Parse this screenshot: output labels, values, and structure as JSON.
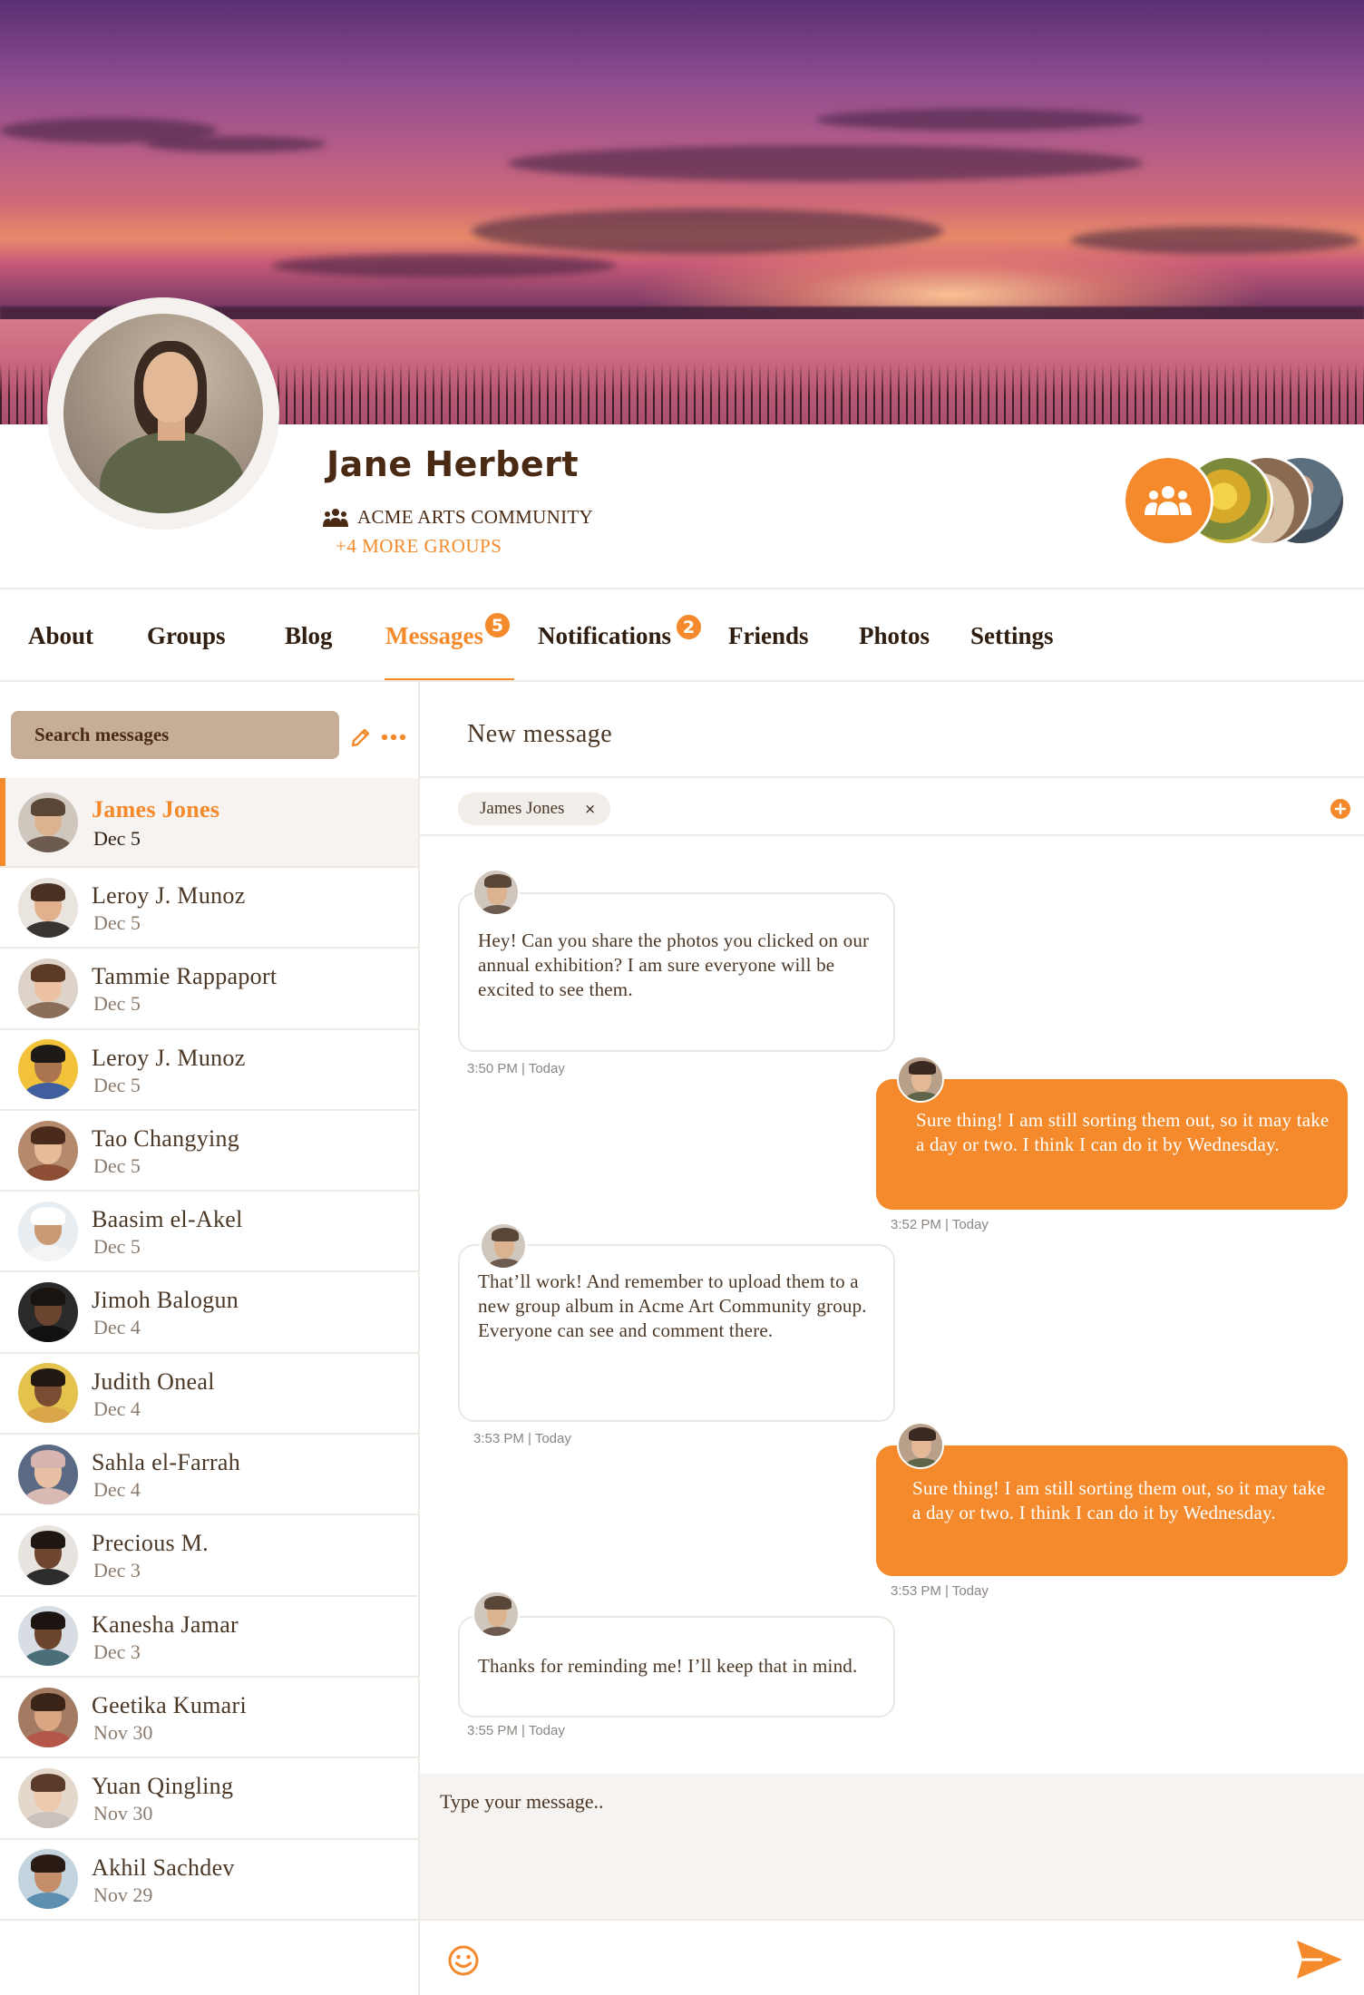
{
  "profile": {
    "name": "Jane Herbert",
    "community": "ACME ARTS COMMUNITY",
    "more_groups": "+4 MORE GROUPS"
  },
  "tabs": [
    {
      "label": "About"
    },
    {
      "label": "Groups"
    },
    {
      "label": "Blog"
    },
    {
      "label": "Messages",
      "badge": "5"
    },
    {
      "label": "Notifications",
      "badge": "2"
    },
    {
      "label": "Friends"
    },
    {
      "label": "Photos"
    },
    {
      "label": "Settings"
    }
  ],
  "active_tab": "Messages",
  "sidebar": {
    "search_placeholder": "Search messages",
    "contacts": [
      {
        "name": "James Jones",
        "date": "Dec 5"
      },
      {
        "name": "Leroy J. Munoz",
        "date": "Dec 5"
      },
      {
        "name": "Tammie Rappaport",
        "date": "Dec 5"
      },
      {
        "name": "Leroy J. Munoz",
        "date": "Dec 5"
      },
      {
        "name": "Tao Changying",
        "date": "Dec 5"
      },
      {
        "name": "Baasim el-Akel",
        "date": "Dec 5"
      },
      {
        "name": "Jimoh Balogun",
        "date": "Dec 4"
      },
      {
        "name": "Judith Oneal",
        "date": "Dec 4"
      },
      {
        "name": "Sahla el-Farrah",
        "date": "Dec 4"
      },
      {
        "name": "Precious M.",
        "date": "Dec 3"
      },
      {
        "name": "Kanesha Jamar",
        "date": "Dec 3"
      },
      {
        "name": "Geetika Kumari",
        "date": "Nov 30"
      },
      {
        "name": "Yuan Qingling",
        "date": "Nov 30"
      },
      {
        "name": "Akhil Sachdev",
        "date": "Nov 29"
      }
    ]
  },
  "conversation": {
    "title": "New message",
    "recipient": "James Jones",
    "remove_recipient": "×",
    "messages": [
      {
        "direction": "in",
        "text": "Hey! Can you share the photos you clicked on our annual exhibition? I am sure everyone will be excited to see them.",
        "time": "3:50 PM | Today"
      },
      {
        "direction": "out",
        "text": "Sure thing! I am still sorting them out, so it may take a day or two. I think I can do it by Wednesday.",
        "time": "3:52 PM | Today"
      },
      {
        "direction": "in",
        "text": "That’ll work! And remember to upload them to a new group album in Acme Art Community group. Everyone can see and comment there.",
        "time": "3:53 PM | Today"
      },
      {
        "direction": "out",
        "text": "Sure thing! I am still sorting them out, so it may take a day or two. I think I can do it by Wednesday.",
        "time": "3:53 PM | Today"
      },
      {
        "direction": "in",
        "text": "Thanks for reminding me! I’ll keep that in mind.",
        "time": "3:55 PM | Today"
      }
    ],
    "composer_placeholder": "Type your message.."
  },
  "colors": {
    "accent": "#f48a2b",
    "text_dark": "#4b2a14",
    "search_bg": "#c5ad98"
  },
  "icons": [
    "group-icon",
    "community-icon",
    "edit-icon",
    "more-icon",
    "add-icon",
    "close-icon",
    "emoji-icon",
    "send-icon"
  ]
}
